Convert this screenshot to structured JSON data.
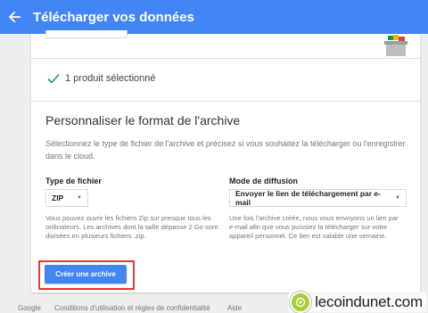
{
  "appbar": {
    "title": "Télécharger vos données",
    "back_icon": "arrow-back-icon",
    "color": "#4285f4"
  },
  "selection": {
    "text": "1 produit sélectionné",
    "check_color": "#0f9d58"
  },
  "format": {
    "title": "Personnaliser le format de l'archive",
    "description": "Sélectionnez le type de fichier de l'archive et précisez si vous souhaitez la télécharger ou l'enregistrer dans le cloud."
  },
  "file_type": {
    "label": "Type de fichier",
    "selected": "ZIP",
    "help": "Vous pouvez ouvrir les fichiers Zip sur presque tous les ordinateurs. Les archives dont la taille dépasse 2 Go sont divisées en plusieurs fichiers .zip."
  },
  "delivery": {
    "label": "Mode de diffusion",
    "selected": "Envoyer le lien de téléchargement par e-mail",
    "help": "Une fois l'archive créée, nous vous envoyons un lien par e-mail afin que vous puissiez la télécharger sur votre appareil personnel. Ce lien est valable une semaine."
  },
  "create_button": {
    "label": "Créer une archive",
    "highlight_color": "#e53935"
  },
  "footer": {
    "google": "Google",
    "terms": "Conditions d'utilisation et règles de confidentialité",
    "help": "Aide"
  },
  "watermark": {
    "text": "lecoindunet.com"
  }
}
